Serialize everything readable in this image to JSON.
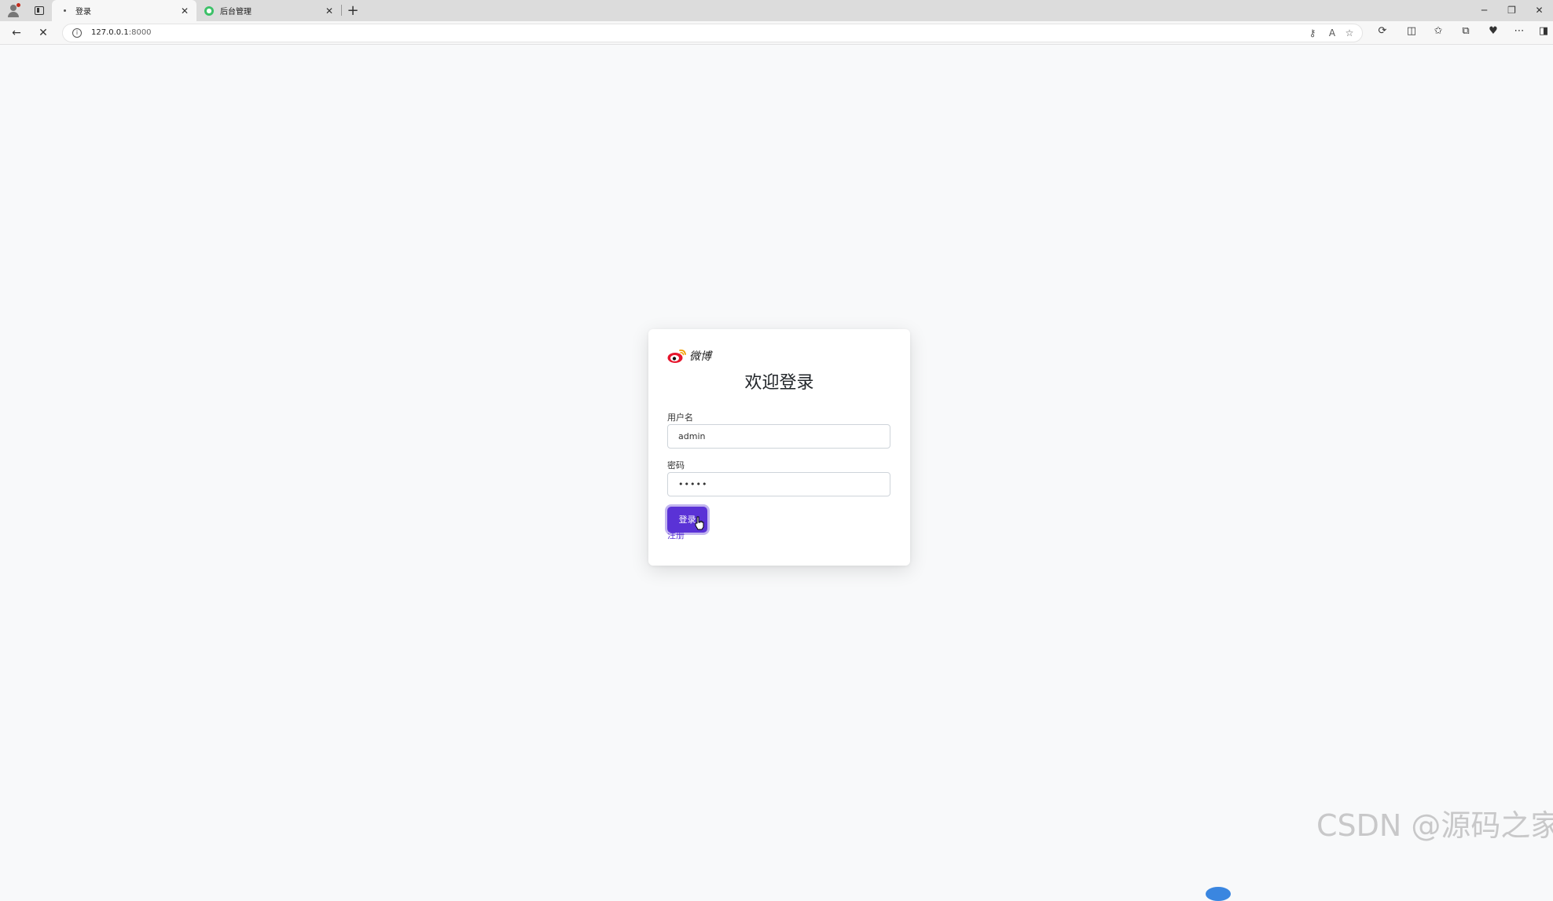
{
  "browser": {
    "tabs": [
      {
        "title": "登录",
        "active": true
      },
      {
        "title": "后台管理",
        "active": false
      }
    ],
    "url_host": "127.0.0.1",
    "url_port": ":8000"
  },
  "login": {
    "logo_text": "微博",
    "title": "欢迎登录",
    "username_label": "用户名",
    "username_value": "admin",
    "password_label": "密码",
    "password_value": "•••••",
    "login_button": "登录",
    "register_link": "注册"
  },
  "colors": {
    "accent": "#5a32d6",
    "page_bg": "#f8f9fa",
    "weibo_red": "#e6162d"
  },
  "watermark": "CSDN @源码之家"
}
